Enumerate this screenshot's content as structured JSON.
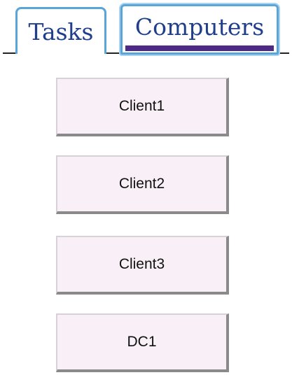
{
  "tabs": {
    "tasks": {
      "label": "Tasks",
      "active": false
    },
    "computers": {
      "label": "Computers",
      "active": true
    }
  },
  "computers": {
    "items": [
      {
        "label": "Client1"
      },
      {
        "label": "Client2"
      },
      {
        "label": "Client3"
      },
      {
        "label": "DC1"
      }
    ]
  },
  "colors": {
    "tab_text": "#1f3f8c",
    "tab_border": "#5aa5d8",
    "active_tab_indicator": "#4d2a86",
    "button_face": "#f8f0f6",
    "button_shadow": "#8a8a8a"
  }
}
